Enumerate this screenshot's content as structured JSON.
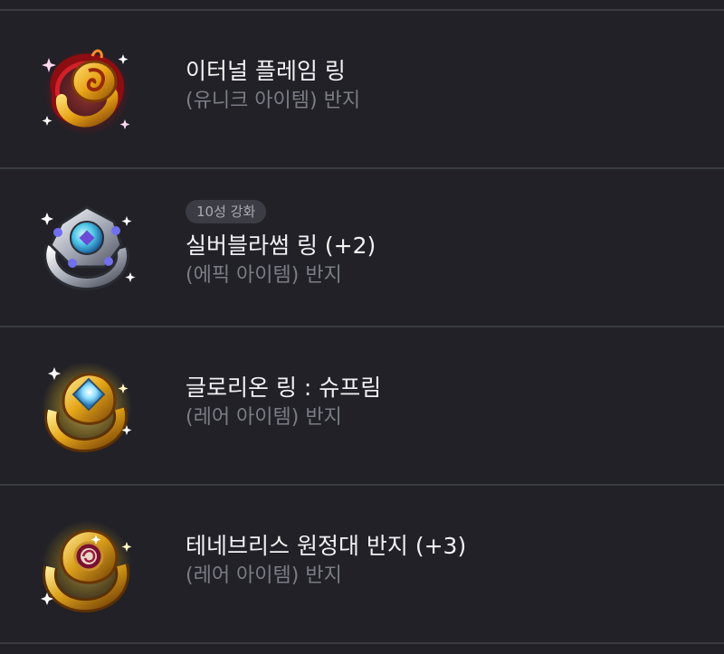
{
  "items": [
    {
      "name": "이터널 플레임 링",
      "type_label": "(유니크 아이템) 반지",
      "badge": "",
      "icon": "eternal-flame-ring-icon",
      "accent": "#c0242a"
    },
    {
      "name": "실버블라썸 링 (+2)",
      "type_label": "(에픽 아이템) 반지",
      "badge": "10성 강화",
      "icon": "silver-blossom-ring-icon",
      "accent": "#8f96a6"
    },
    {
      "name": "글로리온 링 : 슈프림",
      "type_label": "(레어 아이템) 반지",
      "badge": "",
      "icon": "glorion-ring-icon",
      "accent": "#e6b21f"
    },
    {
      "name": "테네브리스 원정대 반지 (+3)",
      "type_label": "(레어 아이템) 반지",
      "badge": "",
      "icon": "tenebris-expedition-ring-icon",
      "accent": "#d9a31c"
    }
  ]
}
